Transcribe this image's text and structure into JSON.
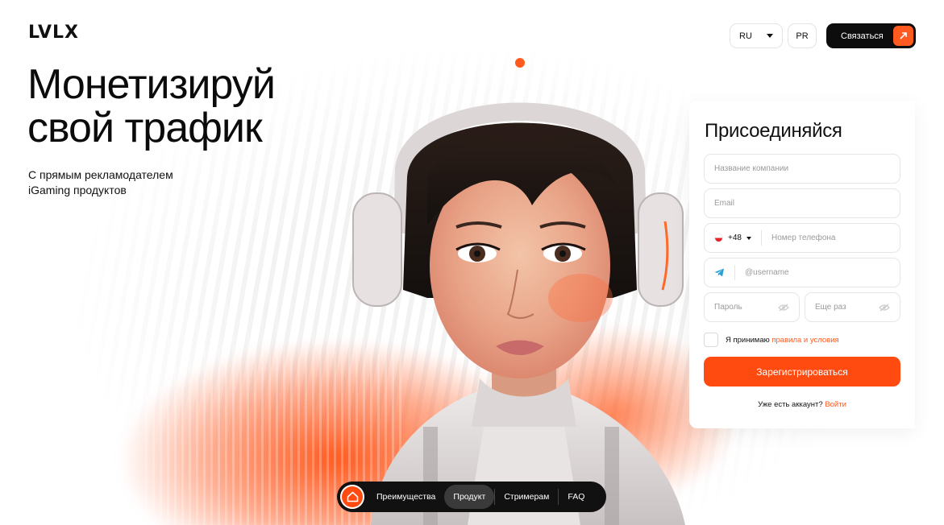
{
  "brand": {
    "logo": "LVLX"
  },
  "header": {
    "language": {
      "selected": "RU"
    },
    "pr_label": "PR",
    "contact_label": "Связаться"
  },
  "hero": {
    "title_line1": "Монетизируй",
    "title_line2": "свой трафик",
    "subtitle_line1": "С прямым рекламодателем",
    "subtitle_line2": "iGaming продуктов"
  },
  "form": {
    "title": "Присоединяйся",
    "company_placeholder": "Название компании",
    "email_placeholder": "Email",
    "phone_code": "+48",
    "phone_placeholder": "Номер телефона",
    "telegram_placeholder": "@username",
    "password_placeholder": "Пароль",
    "repeat_placeholder": "Еще раз",
    "agree_text": "Я принимаю",
    "agree_link": "правила и условия",
    "submit_label": "Зарегистрироваться",
    "login_prompt": "Уже есть аккаунт?",
    "login_link": "Войти"
  },
  "nav": {
    "items": [
      {
        "label": "Преимущества"
      },
      {
        "label": "Продукт",
        "active": true
      },
      {
        "label": "Стримерам"
      },
      {
        "label": "FAQ"
      }
    ]
  },
  "colors": {
    "accent": "#ff4a10",
    "dark": "#111111",
    "link": "#ff5a1f"
  }
}
